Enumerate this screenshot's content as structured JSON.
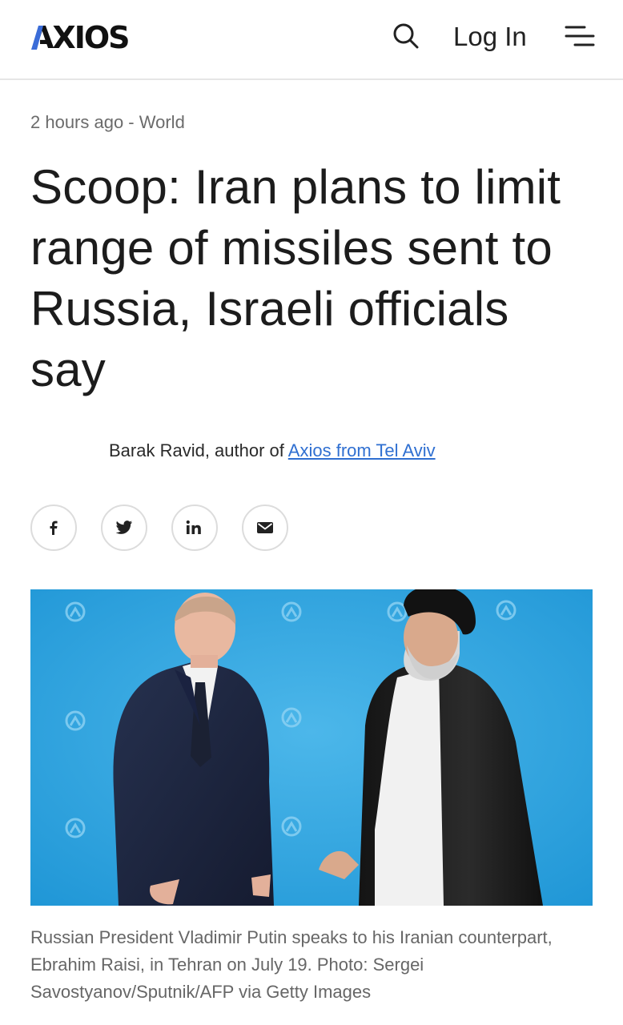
{
  "header": {
    "logo": "AXIOS",
    "login_label": "Log In"
  },
  "article": {
    "meta": "2 hours ago - World",
    "title": "Scoop: Iran plans to limit range of missiles sent to Russia, Israeli officials say",
    "byline_prefix": "Barak Ravid, author of ",
    "byline_link": "Axios from Tel Aviv",
    "caption": "Russian President Vladimir Putin speaks to his Iranian counterpart, Ebrahim Raisi, in Tehran on July 19. Photo: Sergei Savostyanov/Sputnik/AFP via Getty Images"
  },
  "share": [
    {
      "icon": "facebook-icon"
    },
    {
      "icon": "twitter-icon"
    },
    {
      "icon": "linkedin-icon"
    },
    {
      "icon": "email-icon"
    }
  ],
  "colors": {
    "link": "#2f6fd1",
    "logo_accent": "#3a6cd8",
    "photo_background": "#2aa4e0"
  }
}
